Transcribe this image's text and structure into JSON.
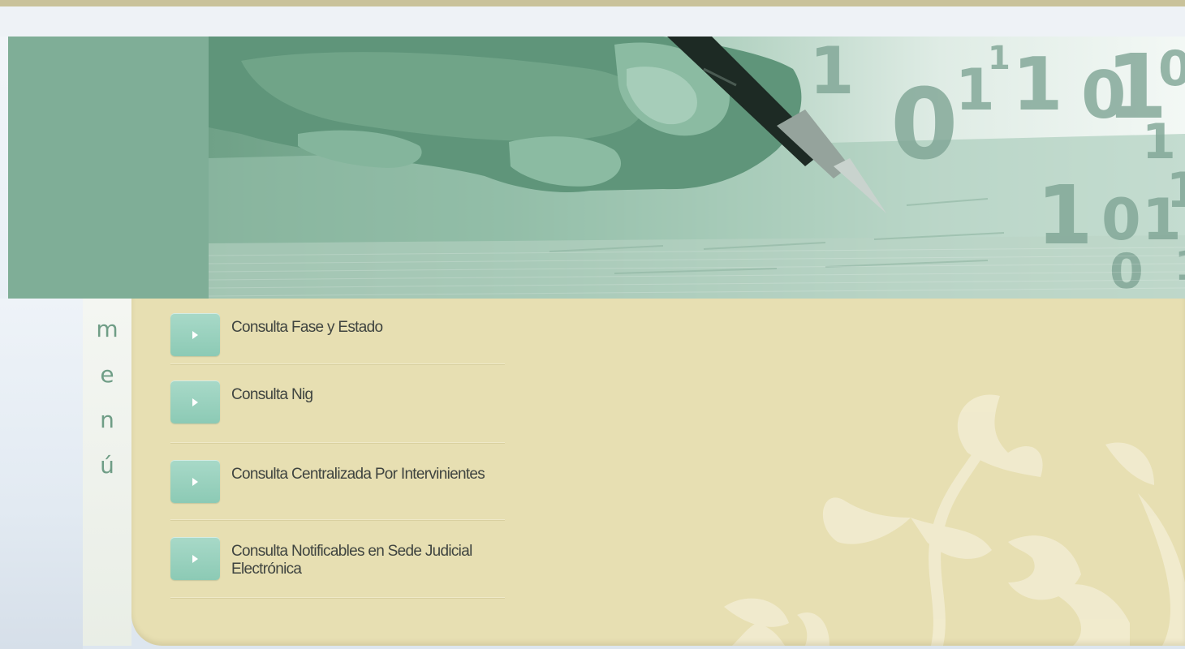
{
  "menu": {
    "heading_letters": [
      "m",
      "e",
      "n",
      "ú"
    ],
    "items": [
      {
        "label": "Consulta Fase y Estado"
      },
      {
        "label": "Consulta Nig"
      },
      {
        "label": "Consulta Centralizada Por Intervinientes"
      },
      {
        "label": "Consulta Notificables en Sede Judicial Electrónica"
      }
    ]
  },
  "banner": {
    "digits": [
      "1",
      "0",
      "1",
      "1",
      "0",
      "1",
      "0",
      "1",
      "1",
      "0",
      "1",
      "1",
      "0",
      "1",
      "1"
    ]
  },
  "colors": {
    "header_green": "#7fae97",
    "panel_cream": "#e7dfb2",
    "menu_green_text": "#6f9d86",
    "button_mint": "#8ccab5",
    "item_text": "#3f4440"
  }
}
